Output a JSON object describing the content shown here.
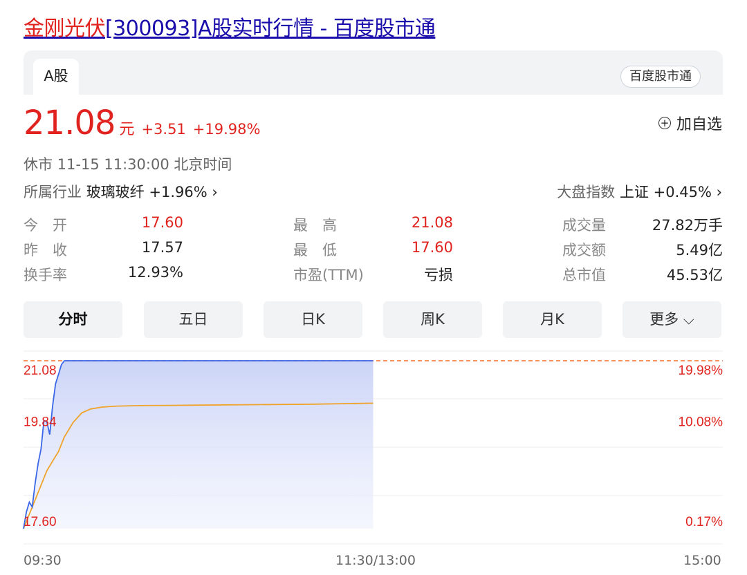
{
  "page": {
    "title_name": "金刚光伏",
    "title_rest": "[300093]A股实时行情 - 百度股市通"
  },
  "tabs": {
    "active": "A股",
    "source": "百度股市通"
  },
  "quote": {
    "price": "21.08",
    "unit": "元",
    "change": "+3.51",
    "change_pct": "+19.98%",
    "add_watch": "加自选",
    "status": "休市  11-15 11:30:00  北京时间",
    "industry_label": "所属行业",
    "industry_value": "玻璃玻纤 +1.96% ›",
    "index_label": "大盘指数",
    "index_value": "上证 +0.45% ›"
  },
  "stats": [
    {
      "label": "今　开",
      "value": "17.60",
      "color": "red"
    },
    {
      "label": "昨　收",
      "value": "17.57",
      "color": "black"
    },
    {
      "label": "换手率",
      "value": "12.93%",
      "color": "black"
    },
    {
      "label": "最　高",
      "value": "21.08",
      "color": "red"
    },
    {
      "label": "最　低",
      "value": "17.60",
      "color": "red"
    },
    {
      "label": "市盈(TTM)",
      "value": "亏损",
      "color": "black"
    },
    {
      "label": "成交量",
      "value": "27.82万手",
      "color": "black"
    },
    {
      "label": "成交额",
      "value": "5.49亿",
      "color": "black"
    },
    {
      "label": "总市值",
      "value": "45.53亿",
      "color": "black"
    }
  ],
  "chart_tabs": [
    "分时",
    "五日",
    "日K",
    "周K",
    "月K",
    "更多"
  ],
  "colors": {
    "up": "#e0231f",
    "price_line": "#3a66e8",
    "avg_line": "#f0a32a",
    "limit_line": "#f26d2b"
  },
  "chart_data": {
    "type": "line",
    "y_left_ticks": [
      "21.08",
      "19.84",
      "17.60"
    ],
    "y_right_ticks": [
      "19.98%",
      "10.08%",
      "0.17%"
    ],
    "x_ticks": [
      "09:30",
      "11:30/13:00",
      "15:00"
    ],
    "ylim": [
      17.6,
      21.08
    ],
    "limit_up": 21.08,
    "session_minutes": 240,
    "series": [
      {
        "role": "price",
        "x_minutes": [
          0,
          1,
          2,
          3,
          4,
          5,
          6,
          7,
          8,
          9,
          10,
          11,
          12,
          13,
          14,
          120
        ],
        "values": [
          17.6,
          17.95,
          18.15,
          18.05,
          18.55,
          18.95,
          19.25,
          19.84,
          19.82,
          19.55,
          20.15,
          20.6,
          20.8,
          21.0,
          21.08,
          21.08
        ]
      },
      {
        "role": "average",
        "x_minutes": [
          0,
          2,
          4,
          6,
          8,
          10,
          12,
          14,
          17,
          20,
          23,
          27,
          32,
          40,
          60,
          80,
          100,
          120
        ],
        "values": [
          17.6,
          17.9,
          18.2,
          18.5,
          18.8,
          19.0,
          19.2,
          19.5,
          19.8,
          20.0,
          20.08,
          20.12,
          20.14,
          20.15,
          20.16,
          20.17,
          20.18,
          20.2
        ]
      }
    ]
  }
}
